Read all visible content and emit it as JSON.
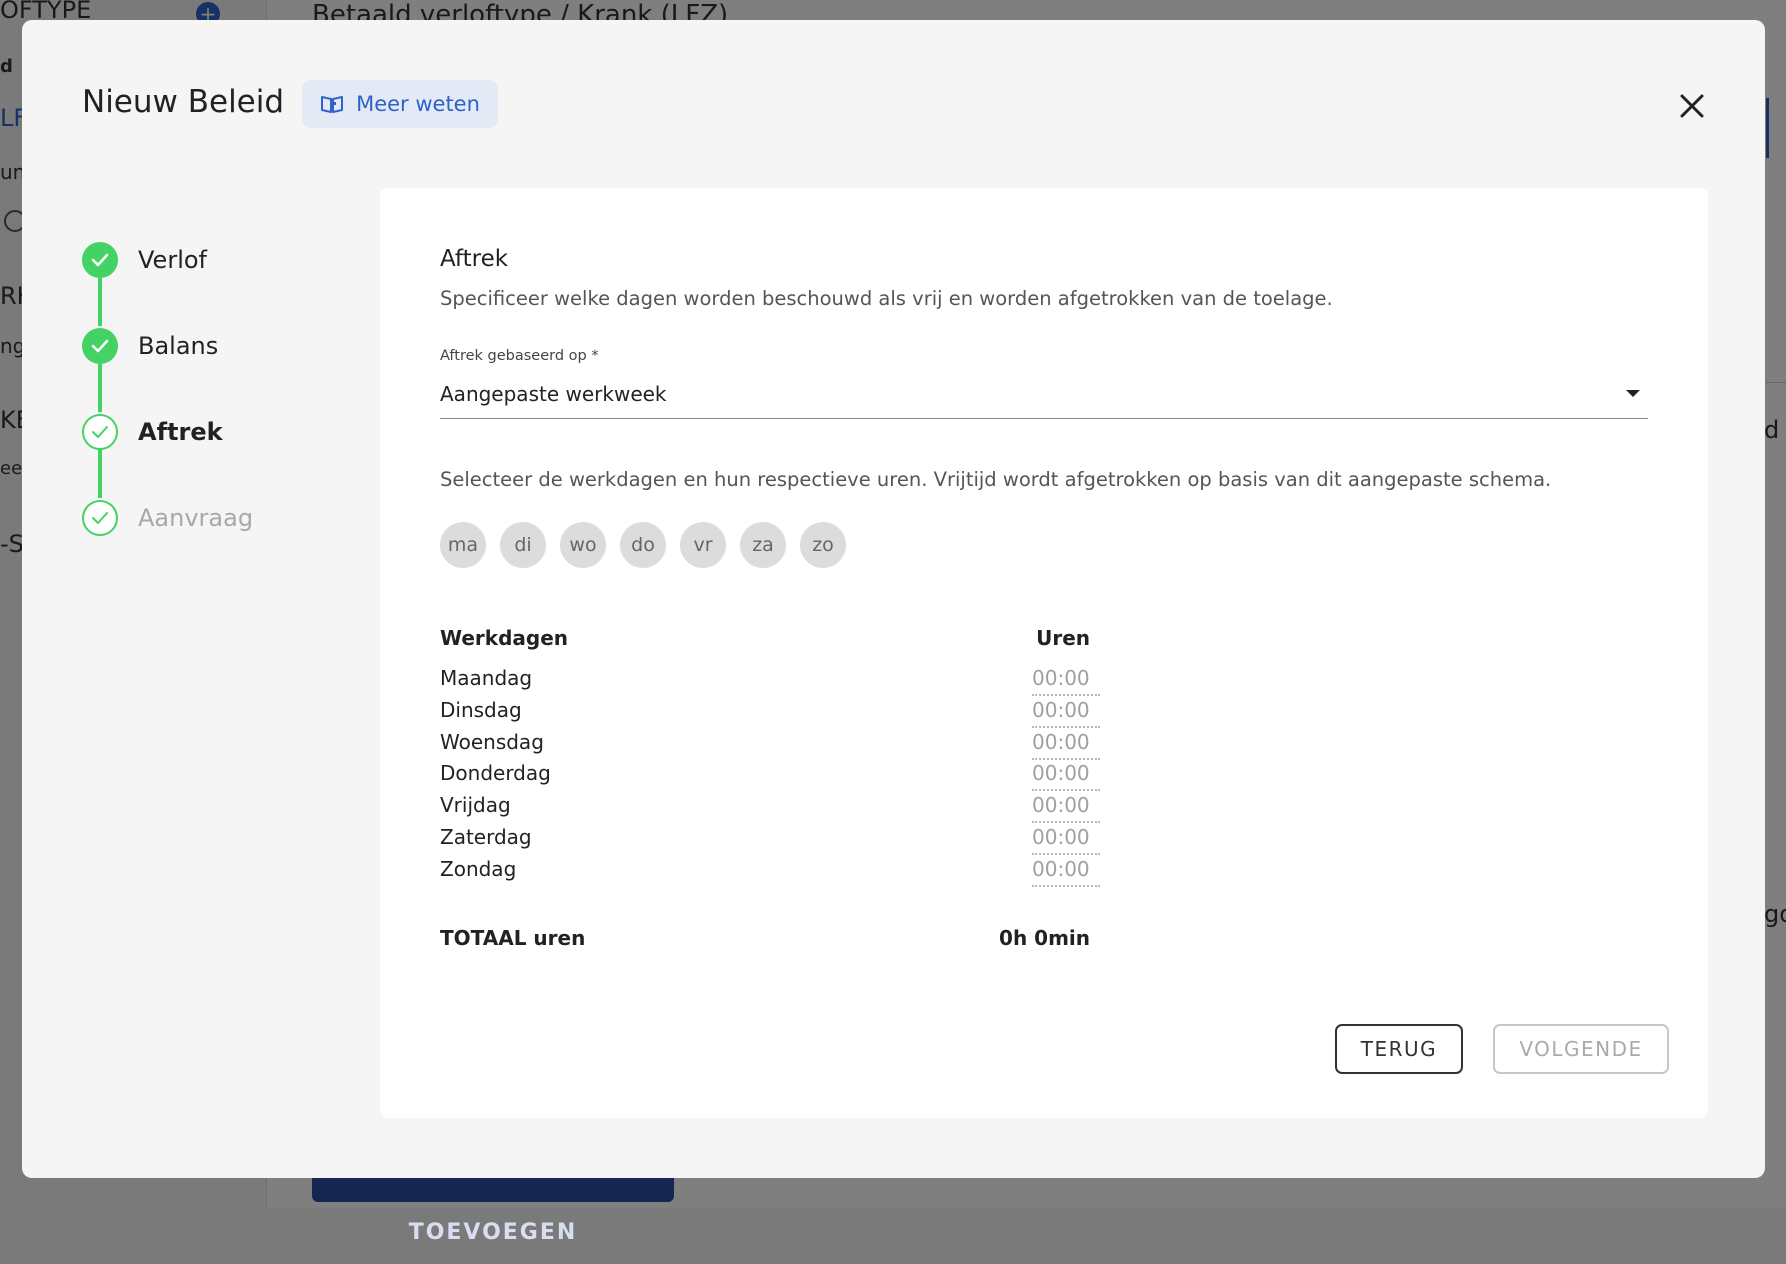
{
  "background": {
    "header_left": "OFTYPE",
    "header_title": "Betaald verloftype / Krank (LFZ)",
    "side_fragments": [
      "d",
      "LF",
      "un",
      "RK",
      "ng",
      "KE",
      "eer",
      "-S"
    ],
    "right_fragments": [
      "d",
      "go"
    ],
    "primary_button": "NIEUW BELEID TOEVOEGEN"
  },
  "modal": {
    "title": "Nieuw Beleid",
    "learn_more": "Meer weten",
    "close_icon": "close-icon"
  },
  "stepper": [
    {
      "label": "Verlof",
      "state": "done"
    },
    {
      "label": "Balans",
      "state": "done"
    },
    {
      "label": "Aftrek",
      "state": "active"
    },
    {
      "label": "Aanvraag",
      "state": "disabled"
    }
  ],
  "section": {
    "title": "Aftrek",
    "description": "Specificeer welke dagen worden beschouwd als vrij en worden afgetrokken van de toelage.",
    "field_label": "Aftrek gebaseerd op *",
    "field_value": "Aangepaste werkweek",
    "help_text": "Selecteer de werkdagen en hun respectieve uren. Vrijtijd wordt afgetrokken op basis van dit aangepaste schema."
  },
  "days": [
    "ma",
    "di",
    "wo",
    "do",
    "vr",
    "za",
    "zo"
  ],
  "table": {
    "col_days": "Werkdagen",
    "col_hours": "Uren",
    "rows": [
      {
        "day": "Maandag",
        "hours": "00:00"
      },
      {
        "day": "Dinsdag",
        "hours": "00:00"
      },
      {
        "day": "Woensdag",
        "hours": "00:00"
      },
      {
        "day": "Donderdag",
        "hours": "00:00"
      },
      {
        "day": "Vrijdag",
        "hours": "00:00"
      },
      {
        "day": "Zaterdag",
        "hours": "00:00"
      },
      {
        "day": "Zondag",
        "hours": "00:00"
      }
    ],
    "total_label": "TOTAAL uren",
    "total_value": "0h 0min"
  },
  "buttons": {
    "back": "TERUG",
    "next": "VOLGENDE"
  },
  "colors": {
    "accent": "#2e62c9",
    "success": "#43d364"
  }
}
